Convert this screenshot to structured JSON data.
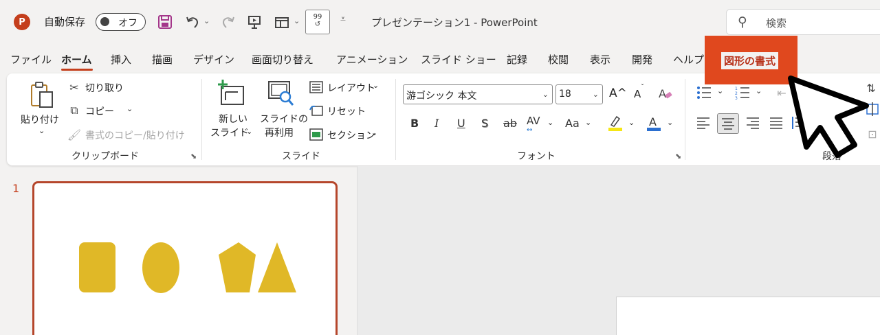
{
  "titlebar": {
    "app_icon": "P",
    "autosave_label": "自動保存",
    "autosave_state": "オフ",
    "doc_title": "プレゼンテーション1  -  PowerPoint",
    "search_placeholder": "検索",
    "icons": [
      "save-icon",
      "undo-icon",
      "redo-icon",
      "present-icon",
      "layout-icon",
      "font-size-icon",
      "customize-icon"
    ]
  },
  "tabs": [
    "ファイル",
    "ホーム",
    "挿入",
    "描画",
    "デザイン",
    "画面切り替え",
    "アニメーション",
    "スライド ショー",
    "記録",
    "校閲",
    "表示",
    "開発",
    "ヘルプ"
  ],
  "active_tab": "ホーム",
  "contextual_tab": "図形の書式",
  "accent_color": "#c43e1c",
  "highlight_color": "#e0481e",
  "ribbon": {
    "clipboard": {
      "paste": "貼り付け",
      "cut": "切り取り",
      "copy": "コピー",
      "format_painter": "書式のコピー/貼り付け",
      "label": "クリップボード"
    },
    "slides": {
      "new_slide_line1": "新しい",
      "new_slide_line2": "スライド",
      "reuse_line1": "スライドの",
      "reuse_line2": "再利用",
      "layout": "レイアウト",
      "reset": "リセット",
      "section": "セクション",
      "label": "スライド"
    },
    "font": {
      "font_name": "游ゴシック 本文",
      "font_size": "18",
      "bold": "B",
      "italic": "I",
      "underline": "U",
      "shadow": "S",
      "strike": "ab",
      "spacing": "AV",
      "case": "Aa",
      "color_a": "A",
      "grow": "A^",
      "shrink": "A",
      "label": "フォント"
    },
    "paragraph": {
      "label": "段落"
    }
  },
  "thumbnails": [
    {
      "number": "1",
      "shapes": [
        "rounded-rectangle",
        "ellipse",
        "pentagon",
        "triangle"
      ],
      "shape_color": "#e0b827"
    }
  ]
}
